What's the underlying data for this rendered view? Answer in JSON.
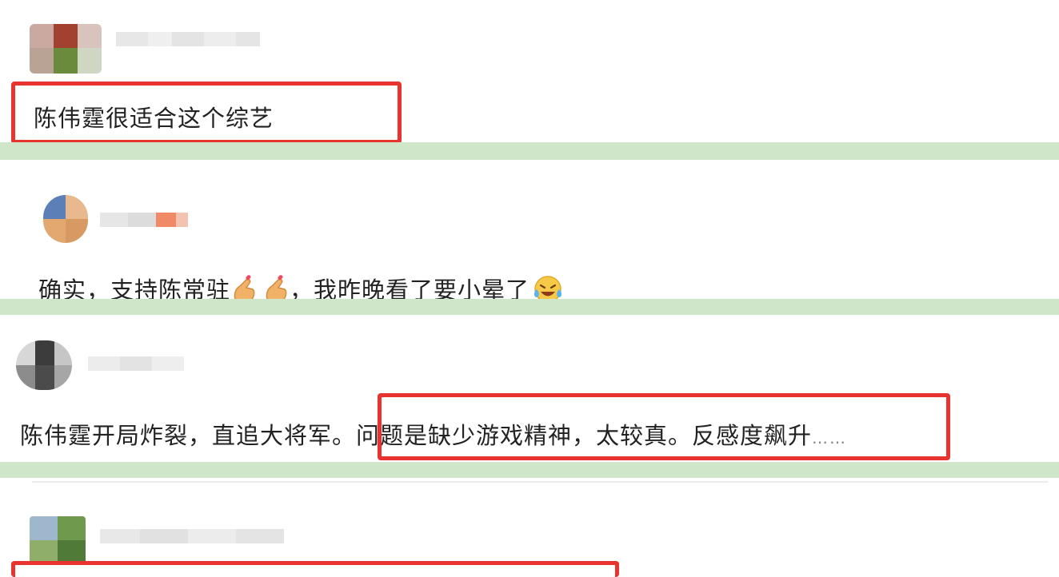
{
  "comments": [
    {
      "text": "陈伟霆很适合这个综艺"
    },
    {
      "text_before": "确实，支持陈常驻",
      "text_after": "，我昨晚看了要小晕了",
      "emojis": [
        "finger-heart-icon",
        "finger-heart-icon",
        "laugh-cry-icon"
      ]
    },
    {
      "text_plain": "陈伟霆开局炸裂，直追大将军。",
      "text_highlight": "问题是缺少游戏精神，太较真。反感度飙升",
      "ellipsis": "……"
    },
    {
      "text": ""
    }
  ],
  "colors": {
    "highlight_border": "#e8332e",
    "separator": "#cfe7c8"
  }
}
